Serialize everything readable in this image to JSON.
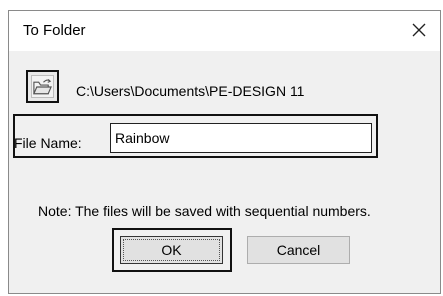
{
  "dialog": {
    "title": "To Folder",
    "close_icon": "close-icon",
    "folder_button_icon": "folder-open-icon",
    "path": "C:\\Users\\Documents\\PE-DESIGN 11",
    "file_name_label": "File Name:",
    "file_name_value": "Rainbow",
    "note": "Note: The files will be saved with sequential numbers.",
    "ok_label": "OK",
    "cancel_label": "Cancel"
  }
}
